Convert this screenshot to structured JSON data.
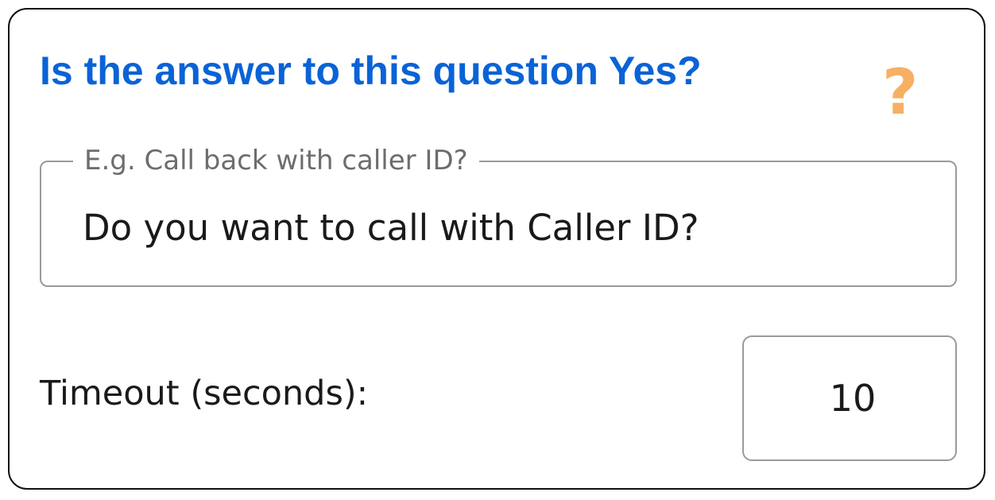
{
  "card": {
    "title": "Is the answer to this question Yes?",
    "help_icon": "question-mark-icon",
    "help_glyph": "?",
    "colors": {
      "title": "#0a63d6",
      "help_icon": "#f6a24a",
      "border": "#111111",
      "field_border": "#9a9a9a"
    }
  },
  "question_field": {
    "legend": "E.g. Call back with caller ID?",
    "value": "Do you want to call with Caller ID?"
  },
  "timeout": {
    "label": "Timeout (seconds):",
    "value": "10"
  }
}
